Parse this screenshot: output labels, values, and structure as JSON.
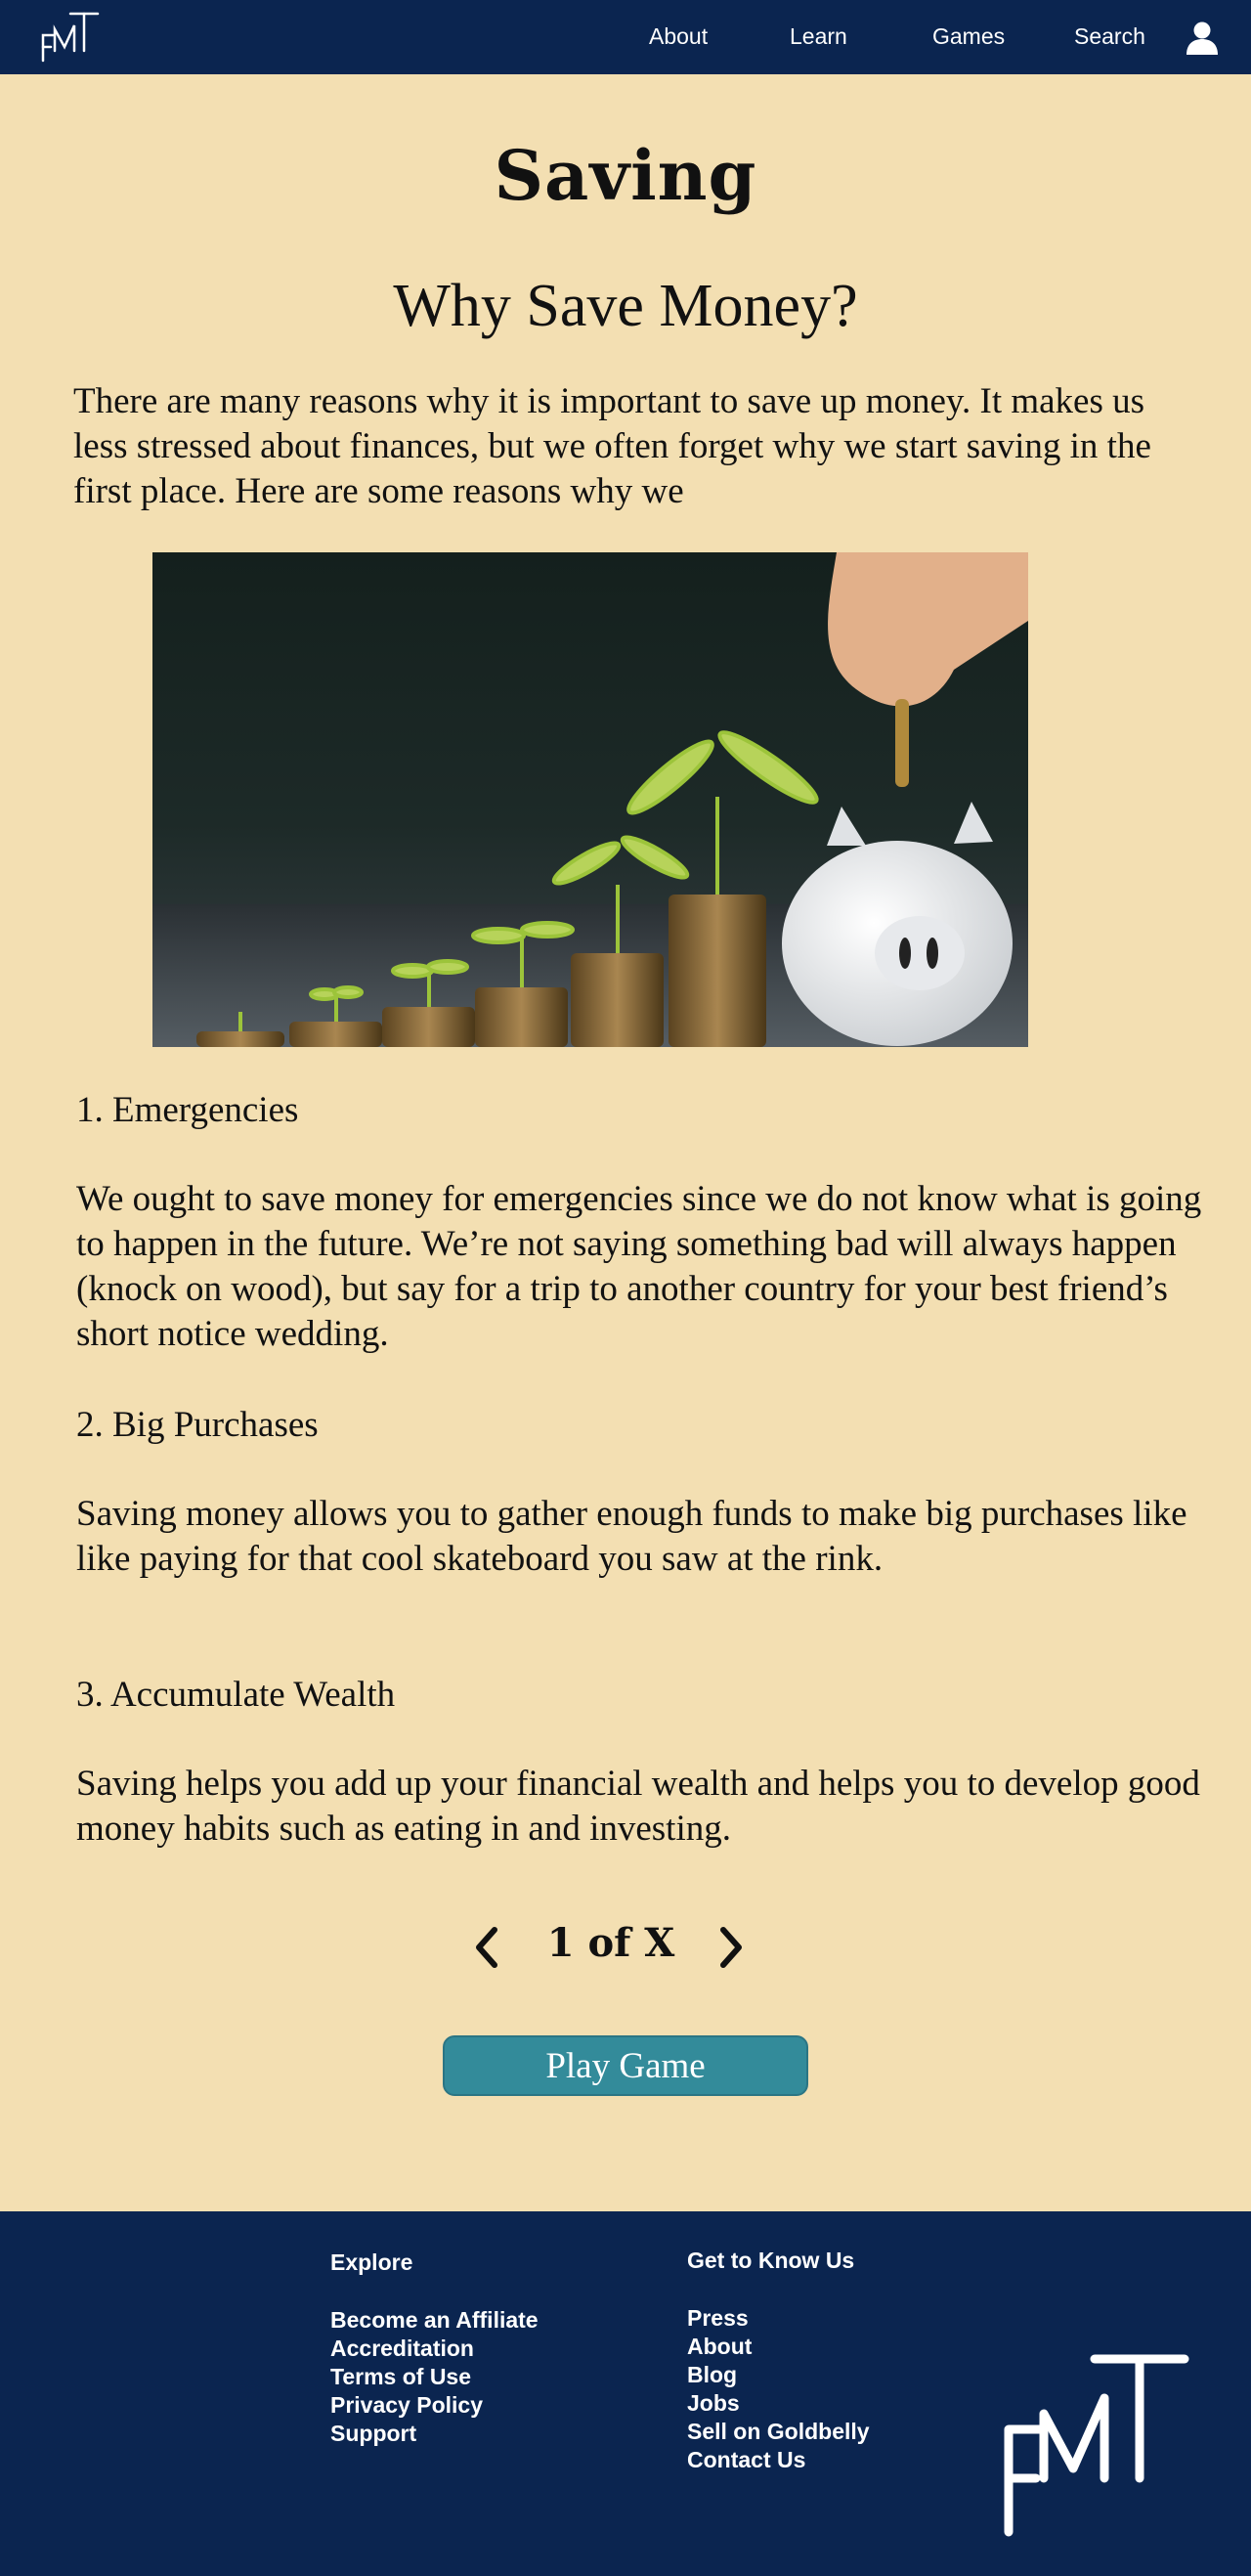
{
  "header": {
    "nav": [
      "About",
      "Learn",
      "Games",
      "Search"
    ]
  },
  "main": {
    "title": "Saving",
    "subtitle": "Why Save Money?",
    "intro": "There are many reasons why it is important to save up money. It makes us less stressed about finances, but we often forget why we start saving in the first place. Here are some reasons why we",
    "sections": [
      {
        "heading": "1. Emergencies",
        "body": "We ought to save money for emergencies since we do not know what is going to happen in the future. We’re not saying something bad will always happen (knock on wood), but say for a trip to another country for your best friend’s short notice wedding."
      },
      {
        "heading": "2. Big Purchases",
        "body": "Saving money allows you to gather enough funds to make big purchases like like paying for that cool skateboard you saw at the rink."
      },
      {
        "heading": "3. Accumulate Wealth",
        "body": "Saving helps you add up your financial wealth and helps you to develop good money habits such as eating in and investing."
      }
    ],
    "pager": "1 of X",
    "play_button": "Play Game"
  },
  "footer": {
    "explore": {
      "heading": "Explore",
      "links": [
        "Become an Affiliate",
        "Accreditation",
        "Terms of Use",
        "Privacy Policy",
        "Support"
      ]
    },
    "know_us": {
      "heading": "Get to Know Us",
      "links": [
        "Press",
        "About",
        "Blog",
        "Jobs",
        "Sell on Goldbelly",
        "Contact Us"
      ]
    }
  },
  "colors": {
    "header_bg": "#0b2550",
    "page_bg": "#f3dfb2",
    "button_bg": "#338b9a"
  }
}
